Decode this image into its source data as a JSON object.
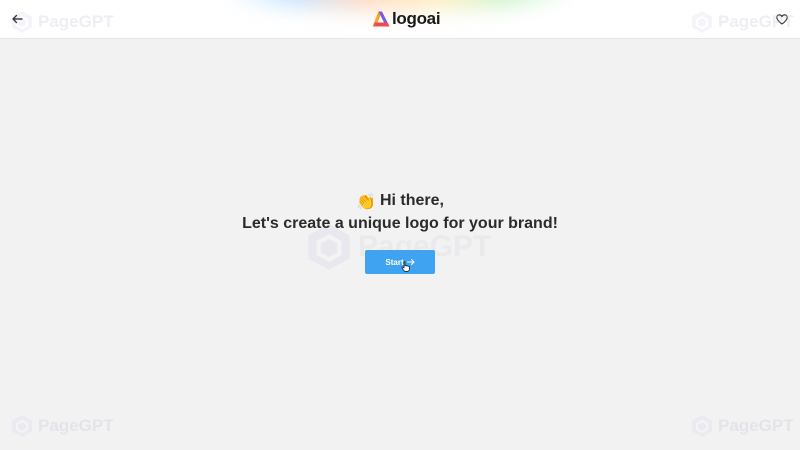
{
  "header": {
    "logo_text": "logoai",
    "back_icon": "arrow-left-icon",
    "favorite_icon": "heart-icon"
  },
  "watermark": {
    "text": "PageGPT"
  },
  "main": {
    "emoji": "👏",
    "greeting": "Hi there,",
    "headline": "Let's create a unique logo for your brand!",
    "start_label": "Start",
    "start_icon": "arrow-right-icon"
  },
  "colors": {
    "accent": "#3fa3f2",
    "background": "#f2f2f2",
    "text": "#2b2b2b"
  }
}
